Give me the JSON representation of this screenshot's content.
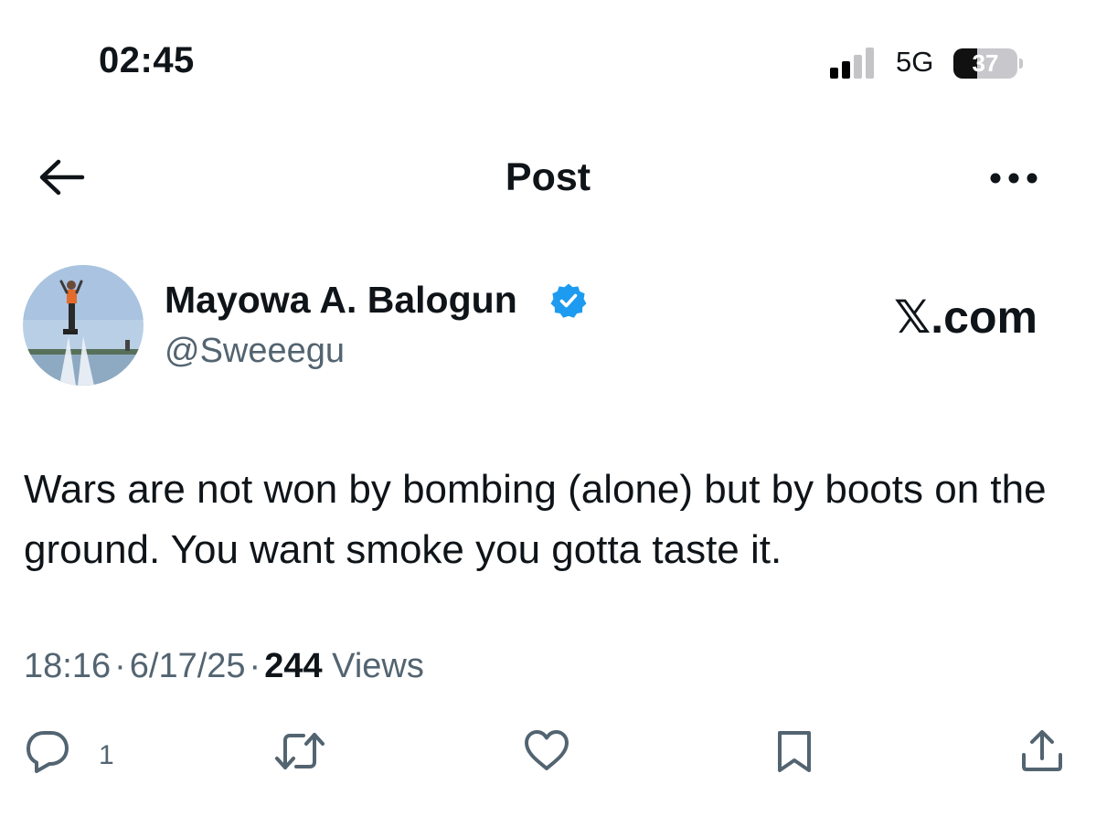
{
  "status_bar": {
    "time": "02:45",
    "network": "5G",
    "battery_level": "37"
  },
  "header": {
    "title": "Post",
    "back_icon": "arrow-left-icon",
    "more_icon": "more-horizontal-icon"
  },
  "author": {
    "display_name": "Mayowa A. Balogun",
    "handle": "@Sweeegu",
    "verified": true,
    "verified_color": "#1d9bf0"
  },
  "watermark": "𝕏.com",
  "tweet": {
    "text": "Wars are not won by bombing (alone) but by boots on the ground. You want smoke you gotta taste it.",
    "time": "18:16",
    "date": "6/17/25",
    "views_count": "244",
    "views_label": "Views"
  },
  "actions": {
    "reply_count": "1",
    "icons": [
      "reply-icon",
      "repost-icon",
      "like-icon",
      "bookmark-icon",
      "share-icon"
    ],
    "icon_color": "#536471"
  },
  "colors": {
    "text_primary": "#0f1419",
    "text_secondary": "#536471",
    "background": "#ffffff"
  }
}
